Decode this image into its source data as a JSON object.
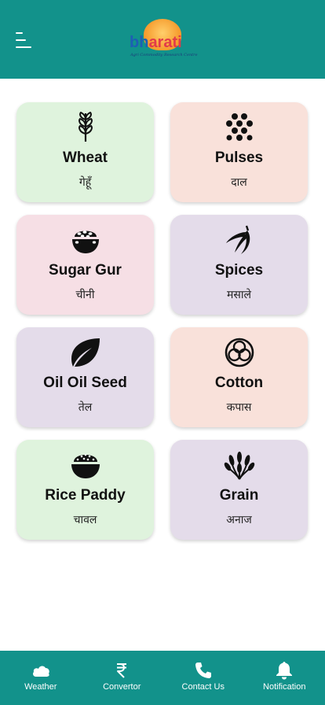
{
  "header": {
    "logo_text_part1": "bh",
    "logo_text_part2": "arati",
    "logo_tagline": "Agri Commodity Research Centre"
  },
  "commodities": [
    {
      "title": "Wheat",
      "hindi": "गेहूँ",
      "bg": "#dff3dd",
      "icon": "wheat-icon"
    },
    {
      "title": "Pulses",
      "hindi": "दाल",
      "bg": "#f9e1da",
      "icon": "pulses-icon"
    },
    {
      "title": "Sugar Gur",
      "hindi": "चीनी",
      "bg": "#f6dfe5",
      "icon": "sugar-bowl-icon"
    },
    {
      "title": "Spices",
      "hindi": "मसाले",
      "bg": "#e4dcea",
      "icon": "chili-icon"
    },
    {
      "title": "Oil Oil Seed",
      "hindi": "तेल",
      "bg": "#e4dcea",
      "icon": "leaf-icon"
    },
    {
      "title": "Cotton",
      "hindi": "कपास",
      "bg": "#f9e1da",
      "icon": "cotton-icon"
    },
    {
      "title": "Rice Paddy",
      "hindi": "चावल",
      "bg": "#dff3dd",
      "icon": "rice-bowl-icon"
    },
    {
      "title": "Grain",
      "hindi": "अनाज",
      "bg": "#e4dcea",
      "icon": "grain-icon"
    }
  ],
  "bottom_nav": [
    {
      "label": "Weather",
      "icon": "cloud-icon"
    },
    {
      "label": "Convertor",
      "icon": "rupee-icon"
    },
    {
      "label": "Contact Us",
      "icon": "phone-icon"
    },
    {
      "label": "Notification",
      "icon": "bell-icon"
    }
  ],
  "colors": {
    "primary": "#12928b"
  }
}
